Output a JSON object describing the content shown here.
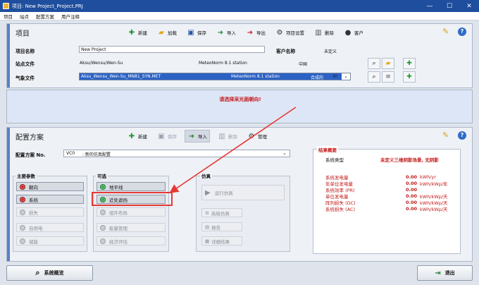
{
  "window": {
    "title": "项目: New Project_Project.PRJ",
    "min": "—",
    "max": "☐",
    "close": "✕"
  },
  "menu": [
    "项目",
    "站点",
    "配置方案",
    "用户注释"
  ],
  "project": {
    "section_title": "项目",
    "toolbar": {
      "new": "新建",
      "load": "加载",
      "save": "保存",
      "import": "导入",
      "export": "导出",
      "settings": "项目设置",
      "delete": "删除",
      "client": "客户"
    },
    "name_label": "项目名称",
    "name_value": "New Project",
    "client_label": "客户名称",
    "client_value": "未定义",
    "site_label": "站点文件",
    "site_name": "Aksu/Wensu/Wen-Su",
    "site_source": "MeteoNorm 8.1 station",
    "site_country": "中国",
    "meteo_label": "气象文件",
    "meteo_file": "Aksu_Wensu_Wen-Su_MN81_SYN.MET",
    "meteo_source": "MeteoNorm 8.1 station",
    "meteo_type": "合成的",
    "meteo_code": "0!"
  },
  "warning": "请选择采光面朝向!",
  "variant": {
    "section_title": "配置方案",
    "toolbar": {
      "new": "新建",
      "save": "保存",
      "import": "导入",
      "delete": "删除",
      "manage": "管理"
    },
    "no_label": "配置方案 No.",
    "no_value": "VC0",
    "no_desc": ": 新的仿真配置",
    "main_params_title": "主要参数",
    "main_params": [
      {
        "label": "朝向",
        "state": "red"
      },
      {
        "label": "系统",
        "state": "red"
      },
      {
        "label": "损失",
        "state": "grey"
      },
      {
        "label": "自用电",
        "state": "grey"
      },
      {
        "label": "储能",
        "state": "grey"
      }
    ],
    "optional_title": "可选",
    "optional": [
      {
        "label": "地平线",
        "state": "green"
      },
      {
        "label": "近处遮挡",
        "state": "green"
      },
      {
        "label": "组件布局",
        "state": "grey"
      },
      {
        "label": "能量管理",
        "state": "grey"
      },
      {
        "label": "经济评估",
        "state": "grey"
      }
    ],
    "simulation_title": "仿真",
    "run_sim": "运行仿真",
    "advanced_sim": "高级仿真",
    "report": "报告",
    "detailed_results": "详细结果"
  },
  "results": {
    "title": "结果概要",
    "system_type_label": "系统类型",
    "system_type_value": "未定义三维阴影场景, 无阴影",
    "rows": [
      {
        "label": "系统发电量",
        "value": "0.00",
        "unit": "kWh/yr"
      },
      {
        "label": "年单位发电量",
        "value": "0.00",
        "unit": "kWh/kWp/年"
      },
      {
        "label": "系统效率 (PR)",
        "value": "0.00",
        "unit": ""
      },
      {
        "label": "单位发电量",
        "value": "0.00",
        "unit": "kWh/kWp/天"
      },
      {
        "label": "阵列损失 (DC)",
        "value": "0.00",
        "unit": "kWh/kWp/天"
      },
      {
        "label": "系统损失 (AC)",
        "value": "0.00",
        "unit": "kWh/kWp/天"
      }
    ]
  },
  "footer": {
    "overview": "系统概览",
    "exit": "退出"
  },
  "colors": {
    "titlebar": "#1f4e9e",
    "accent_red": "#c41818",
    "arrow": "#e53935"
  }
}
